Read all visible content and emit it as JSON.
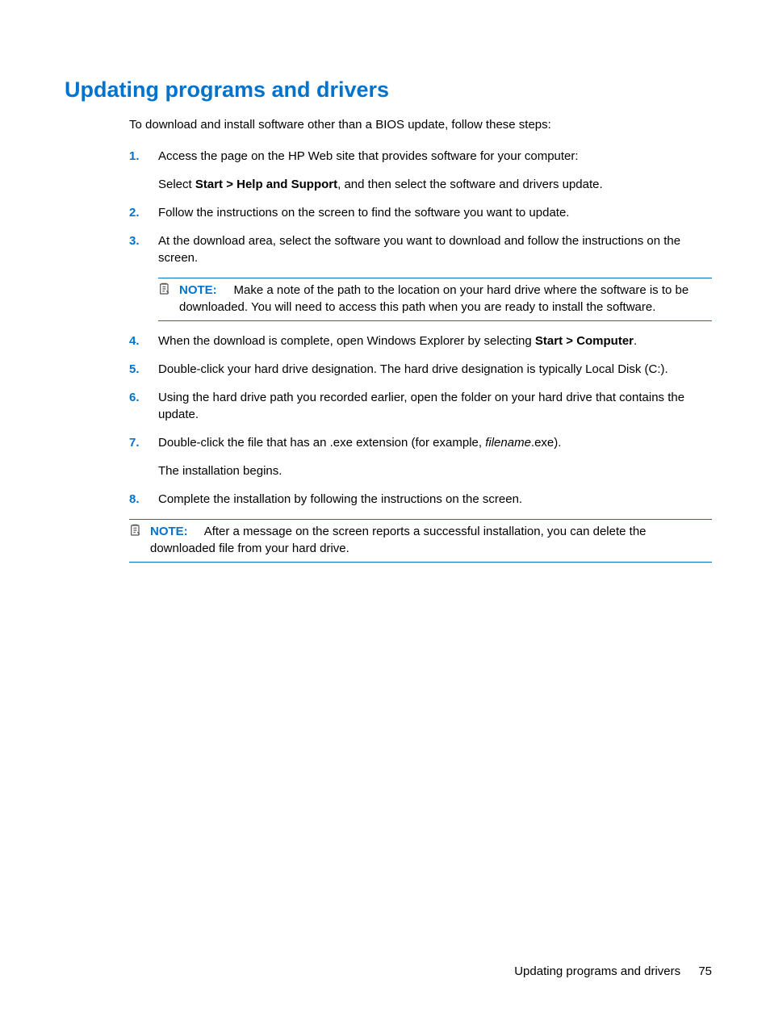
{
  "heading": "Updating programs and drivers",
  "intro": "To download and install software other than a BIOS update, follow these steps:",
  "steps": [
    {
      "num": "1.",
      "p1": "Access the page on the HP Web site that provides software for your computer:",
      "p2_a": "Select ",
      "p2_b": "Start > Help and Support",
      "p2_c": ", and then select the software and drivers update."
    },
    {
      "num": "2.",
      "p1": "Follow the instructions on the screen to find the software you want to update."
    },
    {
      "num": "3.",
      "p1": "At the download area, select the software you want to download and follow the instructions on the screen.",
      "note_label": "NOTE:",
      "note_text": "Make a note of the path to the location on your hard drive where the software is to be downloaded. You will need to access this path when you are ready to install the software."
    },
    {
      "num": "4.",
      "p1_a": "When the download is complete, open Windows Explorer by selecting ",
      "p1_b": "Start > Computer",
      "p1_c": "."
    },
    {
      "num": "5.",
      "p1": "Double-click your hard drive designation. The hard drive designation is typically Local Disk (C:)."
    },
    {
      "num": "6.",
      "p1": "Using the hard drive path you recorded earlier, open the folder on your hard drive that contains the update."
    },
    {
      "num": "7.",
      "p1_a": "Double-click the file that has an .exe extension (for example, ",
      "p1_b": "filename",
      "p1_c": ".exe).",
      "p2": "The installation begins."
    },
    {
      "num": "8.",
      "p1": "Complete the installation by following the instructions on the screen."
    }
  ],
  "outer_note": {
    "label": "NOTE:",
    "text": "After a message on the screen reports a successful installation, you can delete the downloaded file from your hard drive."
  },
  "footer": {
    "title": "Updating programs and drivers",
    "page": "75"
  }
}
